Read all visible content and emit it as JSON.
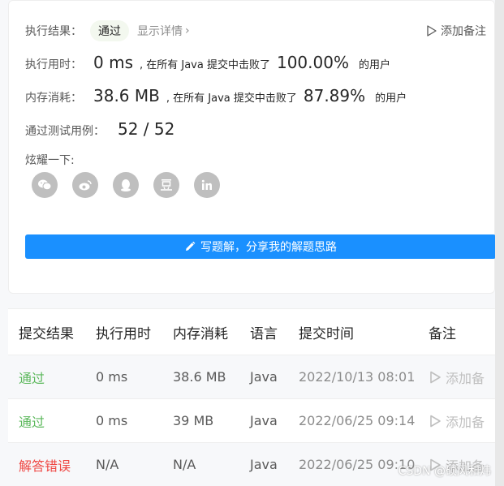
{
  "result": {
    "status_label": "执行结果：",
    "status_value": "通过",
    "details_link": "显示详情",
    "details_chevron": "›",
    "add_note": "添加备注",
    "runtime_label": "执行用时：",
    "runtime_value": "0 ms",
    "runtime_sep": ", 在所有 Java 提交中击败了",
    "runtime_percent": "100.00%",
    "runtime_suffix": "的用户",
    "memory_label": "内存消耗：",
    "memory_value": "38.6 MB",
    "memory_sep": ", 在所有 Java 提交中击败了",
    "memory_percent": "87.89%",
    "memory_suffix": "的用户",
    "tests_label": "通过测试用例：",
    "tests_value": "52 / 52",
    "share_label": "炫耀一下:",
    "share_icons": [
      "wechat-icon",
      "weibo-icon",
      "qq-icon",
      "douban-icon",
      "linkedin-icon"
    ],
    "solution_button": "写题解，分享我的解题思路"
  },
  "submissions": {
    "headers": [
      "提交结果",
      "执行用时",
      "内存消耗",
      "语言",
      "提交时间",
      "备注"
    ],
    "rows": [
      {
        "status": "通过",
        "time": "0 ms",
        "memory": "38.6 MB",
        "language": "Java",
        "date": "2022/10/13 08:01",
        "note": "添加备"
      },
      {
        "status": "通过",
        "time": "0 ms",
        "memory": "39 MB",
        "language": "Java",
        "date": "2022/06/25 09:14",
        "note": "添加备"
      },
      {
        "status": "解答错误",
        "time": "N/A",
        "memory": "N/A",
        "language": "Java",
        "date": "2022/06/25 09:10",
        "note": "添加备"
      }
    ]
  },
  "watermark": "CSDN @硕风和炜",
  "colors": {
    "accent": "#1a90ff",
    "pass": "#5cb85c",
    "fail": "#ef4743",
    "muted": "#8c8c8c"
  }
}
